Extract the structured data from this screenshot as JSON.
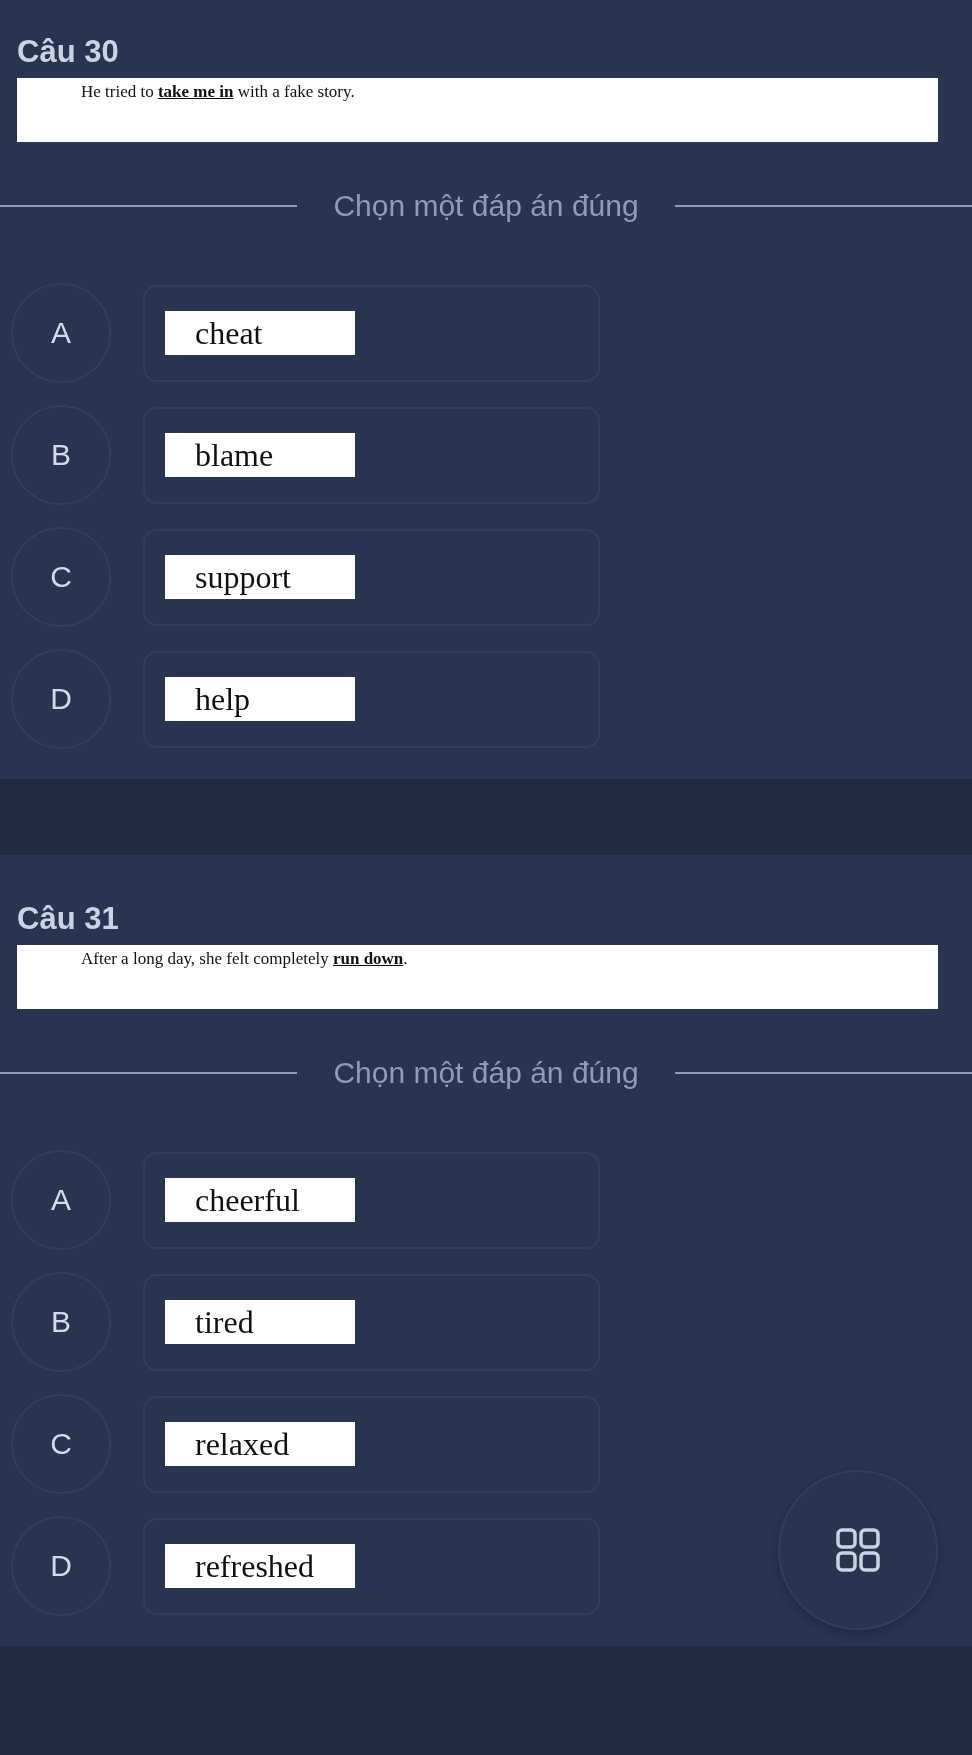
{
  "questions": [
    {
      "title": "Câu 30",
      "prompt": "He tried to **take me in** with a fake story.",
      "instruction": "Chọn một đáp án đúng",
      "options": [
        {
          "letter": "A",
          "text": "cheat"
        },
        {
          "letter": "B",
          "text": "blame"
        },
        {
          "letter": "C",
          "text": "support"
        },
        {
          "letter": "D",
          "text": "help"
        }
      ]
    },
    {
      "title": "Câu 31",
      "prompt": "After a long day, she felt completely **run down**.",
      "instruction": "Chọn một đáp án đúng",
      "options": [
        {
          "letter": "A",
          "text": "cheerful"
        },
        {
          "letter": "B",
          "text": "tired"
        },
        {
          "letter": "C",
          "text": "relaxed"
        },
        {
          "letter": "D",
          "text": "refreshed"
        }
      ]
    }
  ]
}
